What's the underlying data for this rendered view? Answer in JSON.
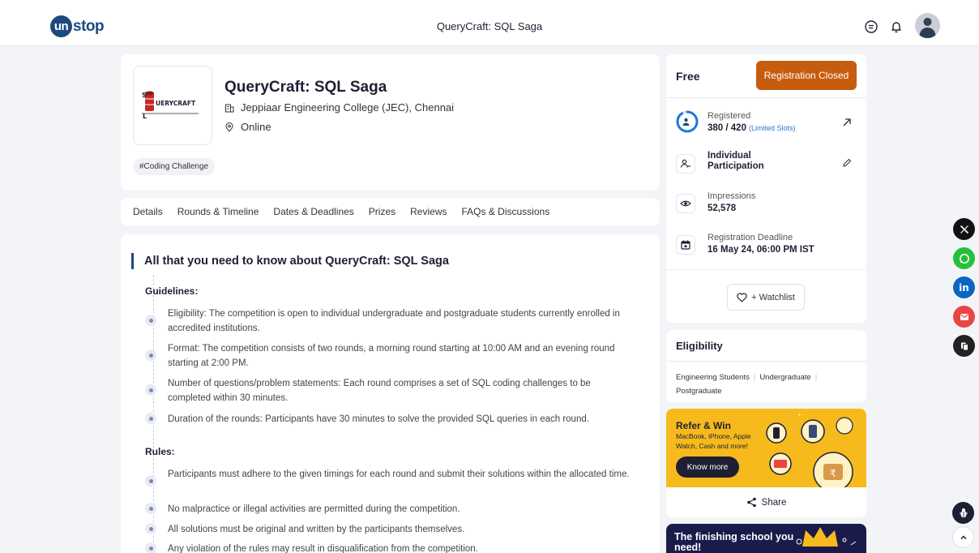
{
  "header": {
    "logo_bold": "un",
    "logo_rest": "stop",
    "title": "QueryCraft: SQL Saga",
    "icons": [
      "chat-icon",
      "bell-icon"
    ]
  },
  "hero": {
    "title": "QueryCraft: SQL Saga",
    "organization": "Jeppiaar Engineering College (JEC), Chennai",
    "location": "Online",
    "tag": "#Coding Challenge",
    "logo_text": "UERYCRAFT"
  },
  "tabs": [
    "Details",
    "Rounds & Timeline",
    "Dates & Deadlines",
    "Prizes",
    "Reviews",
    "FAQs & Discussions"
  ],
  "content": {
    "heading": "All that you need to know about QueryCraft: SQL Saga",
    "guidelines_heading": "Guidelines:",
    "guidelines": [
      "Eligibility: The competition is open to individual undergraduate and postgraduate students currently enrolled in accredited institutions.",
      "Format: The competition consists of two rounds, a morning round starting at 10:00 AM and an evening round starting at 2:00 PM.",
      "Number of questions/problem statements: Each round comprises a set of SQL coding challenges to be completed within 30 minutes.",
      "Duration of the rounds: Participants have 30 minutes to solve the provided SQL queries in each round."
    ],
    "rules_heading": "Rules:",
    "rules": [
      "Participants must adhere to the given timings for each round and submit their solutions within the allocated time.",
      "No malpractice or illegal activities are permitted during the competition.",
      "All solutions must be original and written by the participants themselves.",
      "Any violation of the rules may result in disqualification from the competition."
    ]
  },
  "sidebar": {
    "price": "Free",
    "registration_button": "Registration Closed",
    "registered_label": "Registered",
    "registered_value": "380 / 420",
    "registered_note": "(Limited Slots)",
    "registered_fraction": 0.905,
    "participation_label": "Individual Participation",
    "impressions_label": "Impressions",
    "impressions_value": "52,578",
    "deadline_label": "Registration Deadline",
    "deadline_value": "16 May 24, 06:00 PM IST",
    "watchlist_label": "+ Watchlist"
  },
  "eligibility": {
    "heading": "Eligibility",
    "items": [
      "Engineering Students",
      "Undergraduate",
      "Postgraduate"
    ]
  },
  "promo": {
    "heading": "Refer & Win",
    "subtext": "MacBook, iPhone, Apple Watch, Cash and more!",
    "button": "Know more",
    "share": "Share"
  },
  "school_banner": {
    "text": "The finishing school you need!"
  },
  "colors": {
    "brand": "#1c4980",
    "registration_closed": "#c75c0f",
    "promo_bg": "#f6ba1d",
    "whatsapp": "#25c03b",
    "linkedin": "#0a66c2",
    "email": "#e84545"
  },
  "social": [
    "x-icon",
    "whatsapp-icon",
    "linkedin-icon",
    "email-icon",
    "copy-icon"
  ]
}
